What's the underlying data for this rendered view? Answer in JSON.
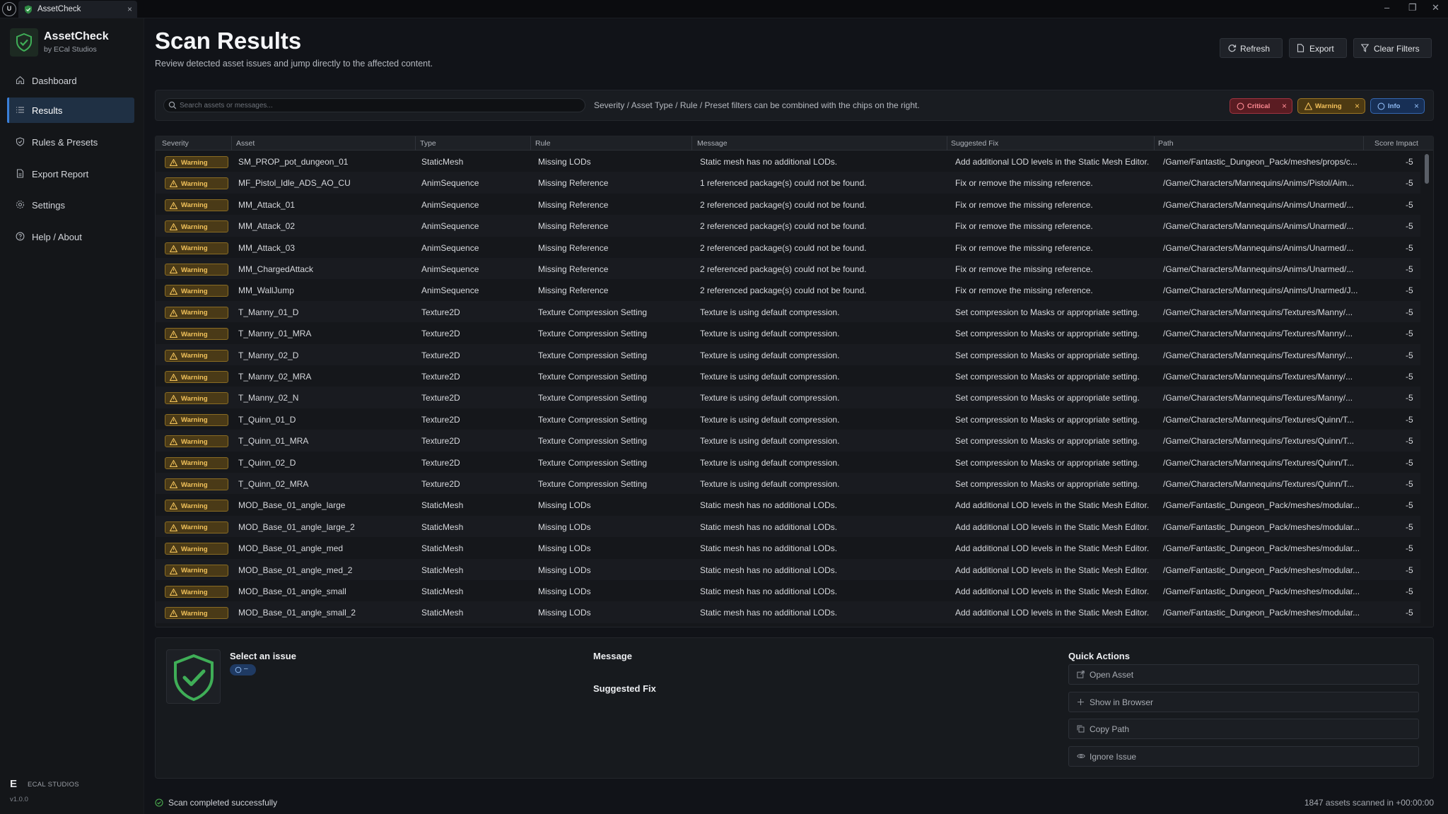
{
  "window": {
    "tab_label": "AssetCheck",
    "tab_close": "×",
    "controls": [
      "–",
      "❐",
      "✕"
    ]
  },
  "brand": {
    "name": "AssetCheck",
    "subtitle": "by ECal Studios"
  },
  "nav": {
    "items": [
      {
        "label": "Dashboard",
        "icon": "home-icon",
        "active": false
      },
      {
        "label": "Results",
        "icon": "list-icon",
        "active": true
      },
      {
        "label": "Rules & Presets",
        "icon": "shield-icon",
        "active": false
      },
      {
        "label": "Export Report",
        "icon": "document-icon",
        "active": false
      },
      {
        "label": "Settings",
        "icon": "gear-icon",
        "active": false
      },
      {
        "label": "Help / About",
        "icon": "help-icon",
        "active": false
      }
    ]
  },
  "footer": {
    "logo_letter": "E",
    "company": "ECAL STUDIOS",
    "version": "v1.0.0"
  },
  "header": {
    "title": "Scan Results",
    "subtitle": "Review detected asset issues and jump directly to the affected content.",
    "buttons": {
      "refresh": "Refresh",
      "export": "Export",
      "clear": "Clear Filters"
    }
  },
  "filters": {
    "search_placeholder": "Search assets or messages...",
    "hint": "Severity / Asset Type / Rule / Preset filters can be combined with the chips on the right.",
    "chips": {
      "critical": "Critical",
      "warning": "Warning",
      "info": "Info",
      "remove": "×"
    }
  },
  "table": {
    "columns": [
      "Severity",
      "Asset",
      "Type",
      "Rule",
      "Message",
      "Suggested Fix",
      "Path",
      "Score Impact"
    ],
    "rows": [
      [
        "Warning",
        "SM_PROP_pot_dungeon_01",
        "StaticMesh",
        "Missing LODs",
        "Static mesh has no additional LODs.",
        "Add additional LOD levels in the Static Mesh Editor.",
        "/Game/Fantastic_Dungeon_Pack/meshes/props/c...",
        "-5"
      ],
      [
        "Warning",
        "MF_Pistol_Idle_ADS_AO_CU",
        "AnimSequence",
        "Missing Reference",
        "1 referenced package(s) could not be found.",
        "Fix or remove the missing reference.",
        "/Game/Characters/Mannequins/Anims/Pistol/Aim...",
        "-5"
      ],
      [
        "Warning",
        "MM_Attack_01",
        "AnimSequence",
        "Missing Reference",
        "2 referenced package(s) could not be found.",
        "Fix or remove the missing reference.",
        "/Game/Characters/Mannequins/Anims/Unarmed/...",
        "-5"
      ],
      [
        "Warning",
        "MM_Attack_02",
        "AnimSequence",
        "Missing Reference",
        "2 referenced package(s) could not be found.",
        "Fix or remove the missing reference.",
        "/Game/Characters/Mannequins/Anims/Unarmed/...",
        "-5"
      ],
      [
        "Warning",
        "MM_Attack_03",
        "AnimSequence",
        "Missing Reference",
        "2 referenced package(s) could not be found.",
        "Fix or remove the missing reference.",
        "/Game/Characters/Mannequins/Anims/Unarmed/...",
        "-5"
      ],
      [
        "Warning",
        "MM_ChargedAttack",
        "AnimSequence",
        "Missing Reference",
        "2 referenced package(s) could not be found.",
        "Fix or remove the missing reference.",
        "/Game/Characters/Mannequins/Anims/Unarmed/...",
        "-5"
      ],
      [
        "Warning",
        "MM_WallJump",
        "AnimSequence",
        "Missing Reference",
        "2 referenced package(s) could not be found.",
        "Fix or remove the missing reference.",
        "/Game/Characters/Mannequins/Anims/Unarmed/J...",
        "-5"
      ],
      [
        "Warning",
        "T_Manny_01_D",
        "Texture2D",
        "Texture Compression Setting",
        "Texture is using default compression.",
        "Set compression to Masks or appropriate setting.",
        "/Game/Characters/Mannequins/Textures/Manny/...",
        "-5"
      ],
      [
        "Warning",
        "T_Manny_01_MRA",
        "Texture2D",
        "Texture Compression Setting",
        "Texture is using default compression.",
        "Set compression to Masks or appropriate setting.",
        "/Game/Characters/Mannequins/Textures/Manny/...",
        "-5"
      ],
      [
        "Warning",
        "T_Manny_02_D",
        "Texture2D",
        "Texture Compression Setting",
        "Texture is using default compression.",
        "Set compression to Masks or appropriate setting.",
        "/Game/Characters/Mannequins/Textures/Manny/...",
        "-5"
      ],
      [
        "Warning",
        "T_Manny_02_MRA",
        "Texture2D",
        "Texture Compression Setting",
        "Texture is using default compression.",
        "Set compression to Masks or appropriate setting.",
        "/Game/Characters/Mannequins/Textures/Manny/...",
        "-5"
      ],
      [
        "Warning",
        "T_Manny_02_N",
        "Texture2D",
        "Texture Compression Setting",
        "Texture is using default compression.",
        "Set compression to Masks or appropriate setting.",
        "/Game/Characters/Mannequins/Textures/Manny/...",
        "-5"
      ],
      [
        "Warning",
        "T_Quinn_01_D",
        "Texture2D",
        "Texture Compression Setting",
        "Texture is using default compression.",
        "Set compression to Masks or appropriate setting.",
        "/Game/Characters/Mannequins/Textures/Quinn/T...",
        "-5"
      ],
      [
        "Warning",
        "T_Quinn_01_MRA",
        "Texture2D",
        "Texture Compression Setting",
        "Texture is using default compression.",
        "Set compression to Masks or appropriate setting.",
        "/Game/Characters/Mannequins/Textures/Quinn/T...",
        "-5"
      ],
      [
        "Warning",
        "T_Quinn_02_D",
        "Texture2D",
        "Texture Compression Setting",
        "Texture is using default compression.",
        "Set compression to Masks or appropriate setting.",
        "/Game/Characters/Mannequins/Textures/Quinn/T...",
        "-5"
      ],
      [
        "Warning",
        "T_Quinn_02_MRA",
        "Texture2D",
        "Texture Compression Setting",
        "Texture is using default compression.",
        "Set compression to Masks or appropriate setting.",
        "/Game/Characters/Mannequins/Textures/Quinn/T...",
        "-5"
      ],
      [
        "Warning",
        "MOD_Base_01_angle_large",
        "StaticMesh",
        "Missing LODs",
        "Static mesh has no additional LODs.",
        "Add additional LOD levels in the Static Mesh Editor.",
        "/Game/Fantastic_Dungeon_Pack/meshes/modular...",
        "-5"
      ],
      [
        "Warning",
        "MOD_Base_01_angle_large_2",
        "StaticMesh",
        "Missing LODs",
        "Static mesh has no additional LODs.",
        "Add additional LOD levels in the Static Mesh Editor.",
        "/Game/Fantastic_Dungeon_Pack/meshes/modular...",
        "-5"
      ],
      [
        "Warning",
        "MOD_Base_01_angle_med",
        "StaticMesh",
        "Missing LODs",
        "Static mesh has no additional LODs.",
        "Add additional LOD levels in the Static Mesh Editor.",
        "/Game/Fantastic_Dungeon_Pack/meshes/modular...",
        "-5"
      ],
      [
        "Warning",
        "MOD_Base_01_angle_med_2",
        "StaticMesh",
        "Missing LODs",
        "Static mesh has no additional LODs.",
        "Add additional LOD levels in the Static Mesh Editor.",
        "/Game/Fantastic_Dungeon_Pack/meshes/modular...",
        "-5"
      ],
      [
        "Warning",
        "MOD_Base_01_angle_small",
        "StaticMesh",
        "Missing LODs",
        "Static mesh has no additional LODs.",
        "Add additional LOD levels in the Static Mesh Editor.",
        "/Game/Fantastic_Dungeon_Pack/meshes/modular...",
        "-5"
      ],
      [
        "Warning",
        "MOD_Base_01_angle_small_2",
        "StaticMesh",
        "Missing LODs",
        "Static mesh has no additional LODs.",
        "Add additional LOD levels in the Static Mesh Editor.",
        "/Game/Fantastic_Dungeon_Pack/meshes/modular...",
        "-5"
      ]
    ]
  },
  "detail": {
    "title": "Select an issue",
    "pill": "–",
    "message_heading": "Message",
    "fix_heading": "Suggested Fix",
    "quick_actions_title": "Quick Actions",
    "actions": [
      "Open Asset",
      "Show in Browser",
      "Copy Path",
      "Ignore Issue"
    ]
  },
  "status": {
    "message": "Scan completed successfully",
    "summary": "1847 assets scanned in +00:00:00"
  },
  "colors": {
    "accent": "#3a7fd8",
    "warning": "#f2c25a",
    "critical": "#ff8a93",
    "info": "#8fbaf2",
    "success": "#4caf50"
  }
}
